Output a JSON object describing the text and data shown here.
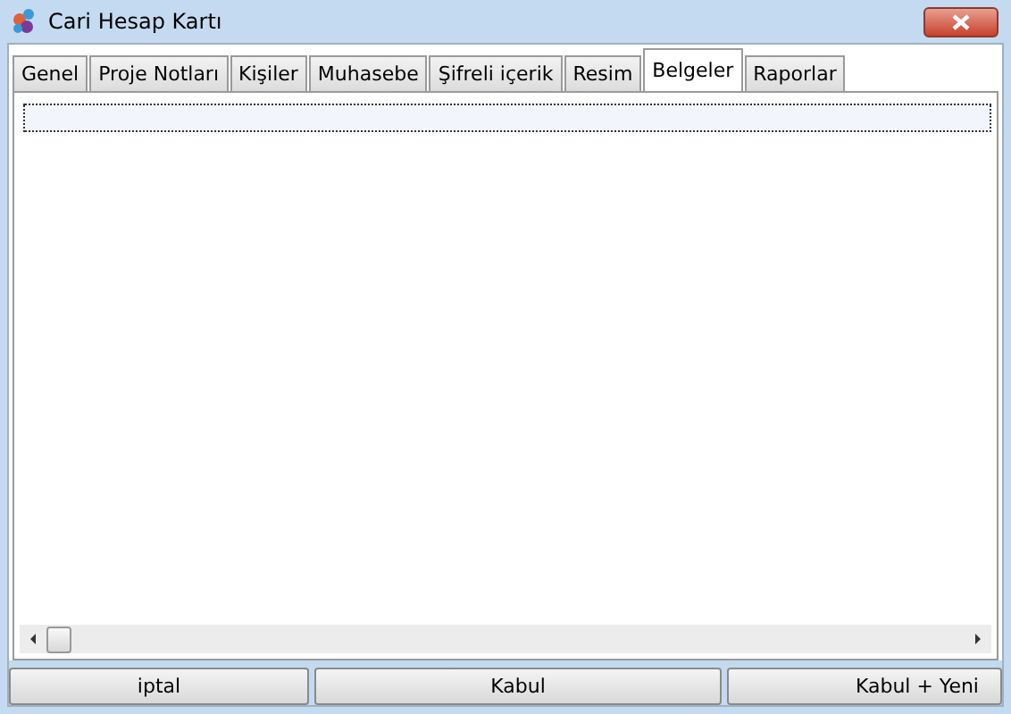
{
  "window": {
    "title": "Cari Hesap Kartı"
  },
  "tabs": [
    {
      "label": "Genel",
      "selected": false
    },
    {
      "label": "Proje Notları",
      "selected": false
    },
    {
      "label": "Kişiler",
      "selected": false
    },
    {
      "label": "Muhasebe",
      "selected": false
    },
    {
      "label": "Şifreli içerik",
      "selected": false
    },
    {
      "label": "Resim",
      "selected": false
    },
    {
      "label": "Belgeler",
      "selected": true
    },
    {
      "label": "Raporlar",
      "selected": false
    }
  ],
  "buttons": [
    {
      "label": "iptal"
    },
    {
      "label": "Kabul"
    },
    {
      "label": "Kabul + Yeni"
    }
  ]
}
